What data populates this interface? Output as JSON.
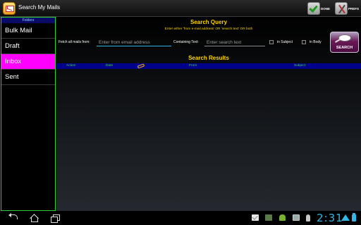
{
  "app": {
    "title": "Search My Mails",
    "done_label": "DONE",
    "prefs_label": "PREFS"
  },
  "sidebar": {
    "header": "Folders",
    "items": [
      {
        "label": "Bulk Mail",
        "active": false
      },
      {
        "label": "Draft",
        "active": false
      },
      {
        "label": "Inbox",
        "active": true
      },
      {
        "label": "Sent",
        "active": false
      }
    ]
  },
  "search_query": {
    "title": "Search Query",
    "hint": "Enter either 'from e-mail address' OR 'search text' OR both",
    "from_label": "Fetch all mails from:",
    "from_placeholder": "Enter from email address",
    "from_value": "",
    "text_label": "Containing Text:",
    "text_placeholder": "Enter search text",
    "text_value": "",
    "in_subject_label": "in Subject",
    "in_subject_checked": false,
    "in_body_label": "in Body",
    "in_body_checked": false,
    "search_button_label": "SEARCH"
  },
  "search_results": {
    "title": "Search Results",
    "columns": {
      "action": "Action",
      "date": "Date",
      "attachment_icon": "paperclip-icon",
      "from": "From",
      "subject": "Subject"
    },
    "rows": []
  },
  "status_bar": {
    "clock": "2:31",
    "accent_color": "#33b5e5"
  },
  "colors": {
    "heading": "#ffd400",
    "active_folder": "#ff00ff",
    "sidebar_border": "#2fcf2f",
    "results_header_bg": "#00008a",
    "results_header_text": "#3fdf3f"
  }
}
